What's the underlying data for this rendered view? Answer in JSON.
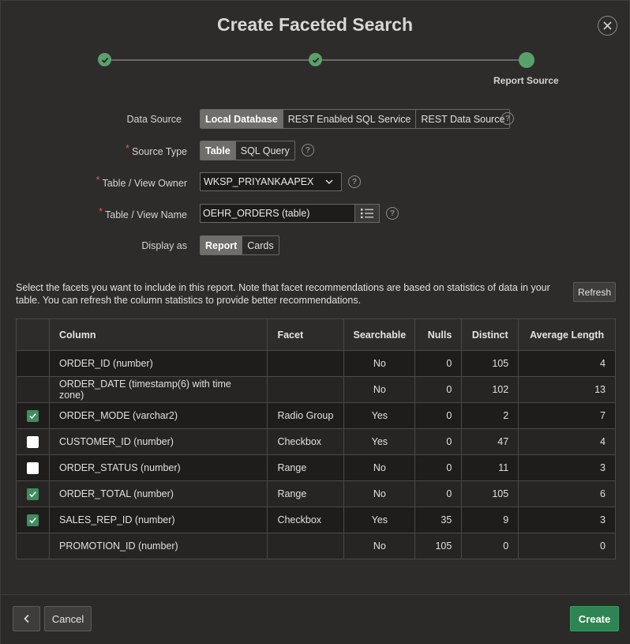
{
  "dialog": {
    "title": "Create Faceted Search",
    "close_icon": "close-icon"
  },
  "wizard": {
    "current_step_label": "Report Source",
    "accent_color": "#5aa06b"
  },
  "form": {
    "data_source": {
      "label": "Data Source",
      "options": [
        "Local Database",
        "REST Enabled SQL Service",
        "REST Data Source"
      ],
      "selected": "Local Database"
    },
    "source_type": {
      "label": "Source Type",
      "options": [
        "Table",
        "SQL Query"
      ],
      "selected": "Table"
    },
    "table_owner": {
      "label": "Table / View Owner",
      "value": "WKSP_PRIYANKAAPEX"
    },
    "table_name": {
      "label": "Table / View Name",
      "value": "OEHR_ORDERS (table)"
    },
    "display_as": {
      "label": "Display as",
      "options": [
        "Report",
        "Cards"
      ],
      "selected": "Report"
    },
    "help_glyph": "?"
  },
  "notice": {
    "text": "Select the facets you want to include in this report. Note that facet recommendations are based on statistics of data in your table. You can refresh the column statistics to provide better recommendations.",
    "refresh_label": "Refresh"
  },
  "table": {
    "headers": [
      "Column",
      "Facet",
      "Searchable",
      "Nulls",
      "Distinct",
      "Average Length"
    ],
    "rows": [
      {
        "checked": null,
        "column": "ORDER_ID (number)",
        "facet": "",
        "searchable": "No",
        "nulls": "0",
        "distinct": "105",
        "avg": "4"
      },
      {
        "checked": null,
        "column": "ORDER_DATE (timestamp(6) with time zone)",
        "facet": "",
        "searchable": "No",
        "nulls": "0",
        "distinct": "102",
        "avg": "13"
      },
      {
        "checked": true,
        "column": "ORDER_MODE (varchar2)",
        "facet": "Radio Group",
        "searchable": "Yes",
        "nulls": "0",
        "distinct": "2",
        "avg": "7"
      },
      {
        "checked": false,
        "column": "CUSTOMER_ID (number)",
        "facet": "Checkbox",
        "searchable": "Yes",
        "nulls": "0",
        "distinct": "47",
        "avg": "4"
      },
      {
        "checked": false,
        "column": "ORDER_STATUS (number)",
        "facet": "Range",
        "searchable": "No",
        "nulls": "0",
        "distinct": "11",
        "avg": "3"
      },
      {
        "checked": true,
        "column": "ORDER_TOTAL (number)",
        "facet": "Range",
        "searchable": "No",
        "nulls": "0",
        "distinct": "105",
        "avg": "6"
      },
      {
        "checked": true,
        "column": "SALES_REP_ID (number)",
        "facet": "Checkbox",
        "searchable": "Yes",
        "nulls": "35",
        "distinct": "9",
        "avg": "3"
      },
      {
        "checked": null,
        "column": "PROMOTION_ID (number)",
        "facet": "",
        "searchable": "No",
        "nulls": "105",
        "distinct": "0",
        "avg": "0"
      }
    ]
  },
  "footer": {
    "cancel_label": "Cancel",
    "create_label": "Create",
    "primary_color": "#2e8452"
  }
}
